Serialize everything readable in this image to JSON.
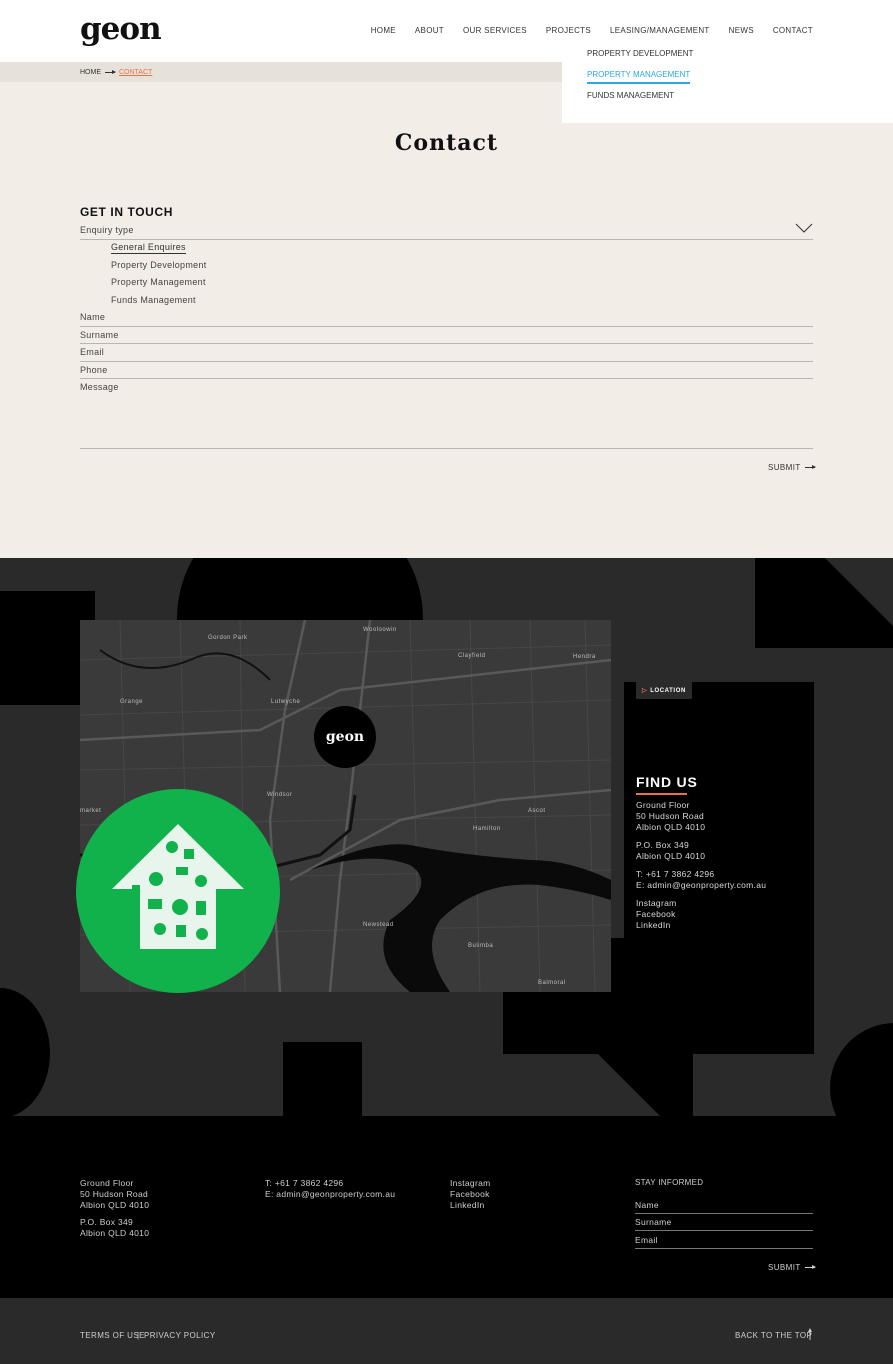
{
  "header": {
    "logo": "geon",
    "nav": [
      "HOME",
      "ABOUT",
      "OUR SERVICES",
      "PROJECTS",
      "LEASING/MANAGEMENT",
      "NEWS",
      "CONTACT"
    ],
    "submenu": [
      "PROPERTY DEVELOPMENT",
      "PROPERTY MANAGEMENT",
      "FUNDS MANAGEMENT"
    ]
  },
  "breadcrumb": {
    "home": "HOME",
    "current": "CONTACT"
  },
  "page": {
    "title": "Contact"
  },
  "form": {
    "heading": "GET IN TOUCH",
    "enquiry_label": "Enquiry type",
    "enquiry_options": [
      "General Enquires",
      "Property Development",
      "Property Management",
      "Funds Management"
    ],
    "name_label": "Name",
    "surname_label": "Surname",
    "email_label": "Email",
    "phone_label": "Phone",
    "message_label": "Message",
    "submit_label": "SUBMIT"
  },
  "map": {
    "labels": [
      "Wooloowin",
      "Gordon Park",
      "Clayfield",
      "Hendra",
      "Grange",
      "Lutwyche",
      "Windsor",
      "Ascot",
      "Hamilton",
      "market",
      "Newstead",
      "Bulimba",
      "Balmoral"
    ],
    "pin_logo": "geon"
  },
  "find_us": {
    "tag": "LOCATION",
    "title": "FIND US",
    "address": [
      "Ground Floor",
      "50 Hudson Road",
      "Albion QLD 4010"
    ],
    "po_box": [
      "P.O. Box 349",
      "Albion QLD 4010"
    ],
    "contact": [
      "T: +61 7 3862 4296",
      "E: admin@geonproperty.com.au"
    ],
    "social": [
      "Instagram",
      "Facebook",
      "LinkedIn"
    ]
  },
  "footer": {
    "address": [
      "Ground Floor",
      "50 Hudson Road",
      "Albion QLD 4010"
    ],
    "po_box": [
      "P.O. Box 349",
      "Albion QLD 4010"
    ],
    "contact": [
      "T: +61 7 3862 4296",
      "E: admin@geonproperty.com.au"
    ],
    "social": [
      "Instagram",
      "Facebook",
      "LinkedIn"
    ],
    "newsletter": {
      "heading": "STAY INFORMED",
      "name_label": "Name",
      "surname_label": "Surname",
      "email_label": "Email",
      "submit_label": "SUBMIT"
    }
  },
  "bottom": {
    "terms": "TERMS OF USE",
    "separator": "|",
    "privacy": "PRIVACY POLICY",
    "back_to_top": "BACK TO THE TOP"
  },
  "colors": {
    "accent": "#e8734a",
    "active_submenu": "#2aa9e0",
    "green": "#11b14b",
    "cream": "#f3ede8",
    "dark": "#2a2a2a"
  }
}
